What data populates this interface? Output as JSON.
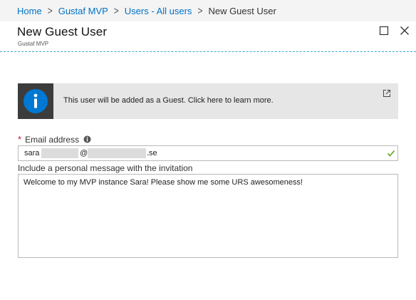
{
  "breadcrumb": {
    "items": [
      {
        "label": "Home"
      },
      {
        "label": "Gustaf MVP"
      },
      {
        "label": "Users - All users"
      },
      {
        "label": "New Guest User"
      }
    ],
    "separator": ">"
  },
  "header": {
    "title": "New Guest User",
    "subtitle": "Gustaf MVP",
    "buttons": [
      "maximize-icon",
      "close-icon"
    ]
  },
  "info_banner": {
    "icon": "info-icon",
    "text": "This user will be added as a Guest. Click here to learn more.",
    "link_icon": "external-link-icon"
  },
  "email": {
    "required_mark": "*",
    "label": "Email address",
    "value_prefix": "sara",
    "value_at": "@",
    "value_suffix": ".se",
    "status_icon": "checkmark-icon"
  },
  "message": {
    "label": "Include a personal message with the invitation",
    "value": "Welcome to my MVP instance Sara! Please show me some URS awesomeness!"
  },
  "colors": {
    "link": "#0072c6",
    "info_blue": "#0078d4",
    "required": "#c8102e",
    "valid_green": "#5ea51a",
    "accent_dashed": "#3ba6d6"
  }
}
